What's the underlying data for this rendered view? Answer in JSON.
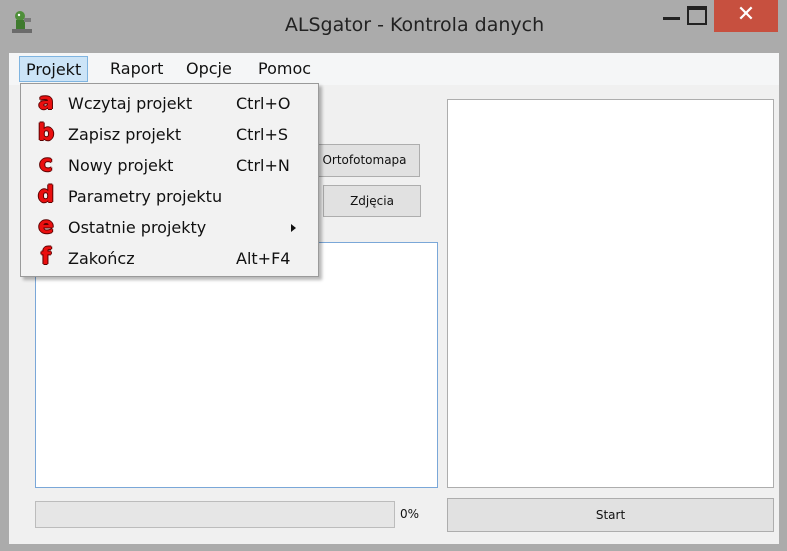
{
  "window": {
    "title": "ALSgator - Kontrola danych",
    "close_glyph": "✕",
    "icon": "app-figure-icon"
  },
  "menubar": {
    "items": [
      {
        "label": "Projekt",
        "active": true
      },
      {
        "label": "Raport"
      },
      {
        "label": "Opcje"
      },
      {
        "label": "Pomoc"
      }
    ]
  },
  "projekt_menu": {
    "items": [
      {
        "marker": "a",
        "label": "Wczytaj projekt",
        "shortcut": "Ctrl+O"
      },
      {
        "marker": "b",
        "label": "Zapisz projekt",
        "shortcut": "Ctrl+S"
      },
      {
        "marker": "c",
        "label": "Nowy projekt",
        "shortcut": "Ctrl+N"
      },
      {
        "marker": "d",
        "label": "Parametry projektu",
        "shortcut": ""
      },
      {
        "marker": "e",
        "label": "Ostatnie projekty",
        "shortcut": "",
        "submenu": true
      },
      {
        "marker": "f",
        "label": "Zakończ",
        "shortcut": "Alt+F4"
      }
    ]
  },
  "buttons": {
    "ortofotomapa": "Ortofotomapa",
    "zdjecia": "Zdjęcia",
    "start": "Start"
  },
  "progress": {
    "value": 0,
    "text": "0%"
  },
  "colors": {
    "marker_red": "#ea0f0f",
    "close_button": "#c7503f",
    "menu_highlight": "#cce4f7",
    "listbox_border": "#7aa7d8"
  }
}
